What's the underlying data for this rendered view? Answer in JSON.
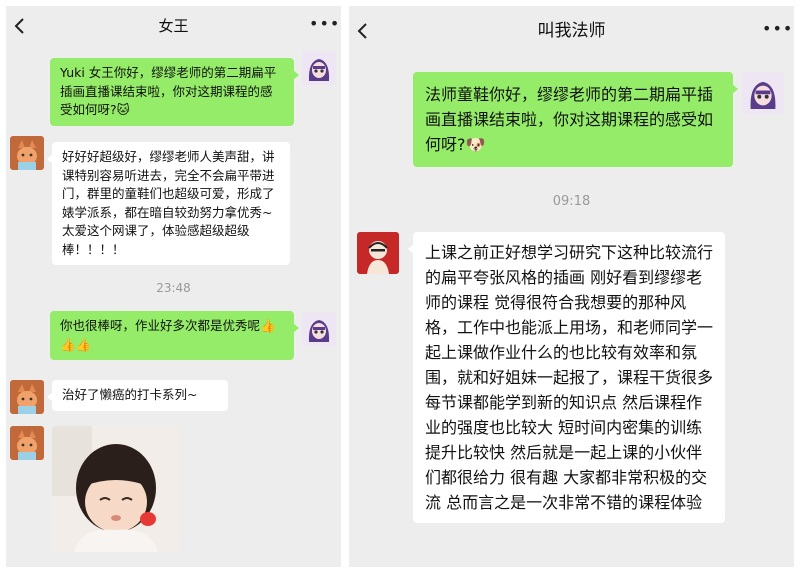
{
  "left_chat": {
    "title": "女王",
    "back_icon": "chevron-left-icon",
    "more_icon": "more-dots-icon",
    "more_text": "•••",
    "messages": [
      {
        "side": "right",
        "text": "Yuki 女王你好，缪缪老师的第二期扁平插画直播课结束啦，你对这期课程的感受如何呀?🐱"
      },
      {
        "side": "left",
        "text": "好好好超级好，缪缪老师人美声甜，讲课特别容易听进去，完全不会扁平带进门，群里的童鞋们也超级可爱，形成了婊学派系，都在暗自较劲努力拿优秀~太爱这个网课了，体验感超级超级棒！！！！"
      },
      {
        "side": "right",
        "text": "你也很棒呀，作业好多次都是优秀呢👍👍👍"
      },
      {
        "side": "left",
        "text": "治好了懒癌的打卡系列~"
      }
    ],
    "timestamp": "23:48"
  },
  "right_chat": {
    "title": "叫我法师",
    "back_icon": "chevron-left-icon",
    "more_icon": "more-dots-icon",
    "more_text": "•••",
    "messages": [
      {
        "side": "right",
        "text": "法师童鞋你好，缪缪老师的第二期扁平插画直播课结束啦，你对这期课程的感受如何呀?🐶"
      },
      {
        "side": "left",
        "text": "上课之前正好想学习研究下这种比较流行的扁平夸张风格的插画 刚好看到缪缪老师的课程 觉得很符合我想要的那种风格，工作中也能派上用场，和老师同学一起上课做作业什么的也比较有效率和氛围，就和好姐妹一起报了，课程干货很多 每节课都能学到新的知识点 然后课程作业的强度也比较大 短时间内密集的训练提升比较快 然后就是一起上课的小伙伴们都很给力 很有趣 大家都非常积极的交流 总而言之是一次非常不错的课程体验"
      }
    ],
    "timestamp": "09:18"
  },
  "colors": {
    "chat_bg": "#ededed",
    "bubble_green": "#95ec69",
    "bubble_white": "#ffffff",
    "timestamp": "#9a9a9a"
  }
}
